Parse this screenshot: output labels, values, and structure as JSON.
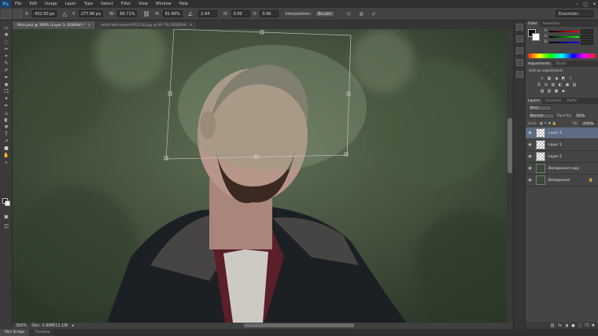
{
  "app": {
    "logo": "Ps"
  },
  "menu": [
    "File",
    "Edit",
    "Image",
    "Layer",
    "Type",
    "Select",
    "Filter",
    "View",
    "Window",
    "Help"
  ],
  "window_controls": [
    "–",
    "□",
    "✕"
  ],
  "options_bar": {
    "x_label": "X:",
    "x_value": "432.50 px",
    "y_label": "Y:",
    "y_value": "277.96 px",
    "w_label": "W:",
    "w_value": "80.71%",
    "h_label": "H:",
    "h_value": "81.66%",
    "angle_value": "2.94",
    "h_skew_label": "H:",
    "h_skew_value": "0.00",
    "v_skew_label": "V:",
    "v_skew_value": "0.00",
    "interp_label": "Interpolation:",
    "interp_value": "Bicubic",
    "essentials": "Essentials"
  },
  "tools": [
    "▭",
    "✤",
    "◌",
    "✂",
    "⌖",
    "✎",
    "✐",
    "✒",
    "◉",
    "❐",
    "✶",
    "✏",
    "△",
    "◐",
    "✥",
    "T",
    "↗",
    "■",
    "✋",
    "⌕"
  ],
  "doc_tabs": [
    {
      "label": "Main.psd @ 300% (Layer 3, RGB/8#) *",
      "active": true
    },
    {
      "label": "adult-bald-beard-952130.jpg @ 66.7% (RGB/8#)",
      "active": false
    }
  ],
  "status": {
    "zoom": "300%",
    "doc": "Doc: 3.99M/11.1M"
  },
  "bottom_tabs": [
    {
      "label": "Mini Bridge",
      "active": true
    },
    {
      "label": "Timeline",
      "active": false
    }
  ],
  "color_panel": {
    "tabs": [
      "Color",
      "Swatches"
    ],
    "channels": [
      "R",
      "G",
      "B"
    ]
  },
  "adjustments_panel": {
    "tabs": [
      "Adjustments",
      "Styles"
    ],
    "title": "Add an adjustment",
    "row1": [
      "☼",
      "▦",
      "◑",
      "◩",
      "▽"
    ],
    "row2": [
      "☰",
      "⚖",
      "▧",
      "◐",
      "▣",
      "▤"
    ],
    "row3": [
      "▨",
      "▥",
      "▩",
      "▪"
    ]
  },
  "layers_panel": {
    "tabs": [
      "Layers",
      "Channels",
      "Paths"
    ],
    "kind": "Kind",
    "blend": "Normal",
    "opacity_label": "Opacity:",
    "opacity_value": "51%",
    "lock_label": "Lock:",
    "fill_label": "Fill:",
    "fill_value": "100%",
    "layers": [
      {
        "name": "Layer 3",
        "selected": true,
        "thumb": "transparent"
      },
      {
        "name": "Layer 1",
        "selected": false,
        "thumb": "transparent"
      },
      {
        "name": "Layer 2",
        "selected": false,
        "thumb": "transparent"
      },
      {
        "name": "Background copy",
        "selected": false,
        "thumb": "photo"
      },
      {
        "name": "Background",
        "selected": false,
        "thumb": "photo",
        "locked": true
      }
    ],
    "footer_icons": [
      "⛓",
      "fx",
      "◑",
      "●",
      "□",
      "❐",
      "✖"
    ]
  }
}
